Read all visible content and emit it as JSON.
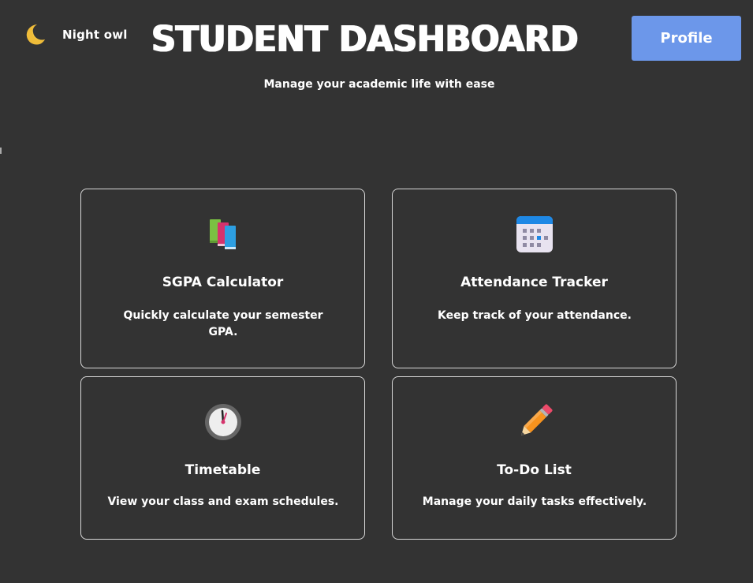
{
  "header": {
    "theme_label": "Night owl",
    "theme_icon": "moon-icon",
    "title": "STUDENT DASHBOARD",
    "profile_label": "Profile",
    "subtitle": "Manage your academic life with ease"
  },
  "colors": {
    "background": "#333333",
    "accent": "#6c97ea",
    "card_border": "#d8d8d8",
    "text": "#ffffff"
  },
  "cards": [
    {
      "title": "SGPA Calculator",
      "description": "Quickly calculate your semester GPA.",
      "icon": "books-icon"
    },
    {
      "title": "Attendance Tracker",
      "description": "Keep track of your attendance.",
      "icon": "calendar-icon"
    },
    {
      "title": "Timetable",
      "description": "View your class and exam schedules.",
      "icon": "clock-icon"
    },
    {
      "title": "To-Do List",
      "description": "Manage your daily tasks effectively.",
      "icon": "pencil-icon"
    }
  ]
}
